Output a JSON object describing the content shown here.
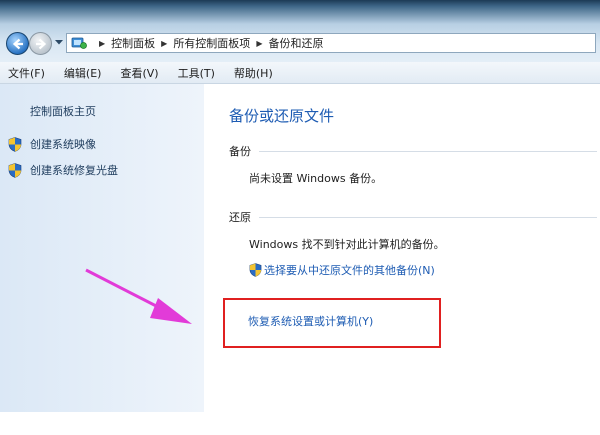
{
  "breadcrumb": {
    "items": [
      "控制面板",
      "所有控制面板项",
      "备份和还原"
    ]
  },
  "menu": {
    "items": [
      "文件(F)",
      "编辑(E)",
      "查看(V)",
      "工具(T)",
      "帮助(H)"
    ]
  },
  "sidebar": {
    "home_label": "控制面板主页",
    "tasks": [
      {
        "label": "创建系统映像",
        "icon": "uac-shield-icon"
      },
      {
        "label": "创建系统修复光盘",
        "icon": "uac-shield-icon"
      }
    ]
  },
  "main": {
    "title": "备份或还原文件",
    "backup": {
      "heading": "备份",
      "status": "尚未设置 Windows 备份。"
    },
    "restore": {
      "heading": "还原",
      "status": "Windows 找不到针对此计算机的备份。",
      "other_backup_link": "选择要从中还原文件的其他备份(N)",
      "recover_link": "恢复系统设置或计算机(Y)"
    }
  },
  "colors": {
    "link": "#1e5cb3",
    "highlight": "#e02020",
    "arrow": "#e23bd8"
  }
}
